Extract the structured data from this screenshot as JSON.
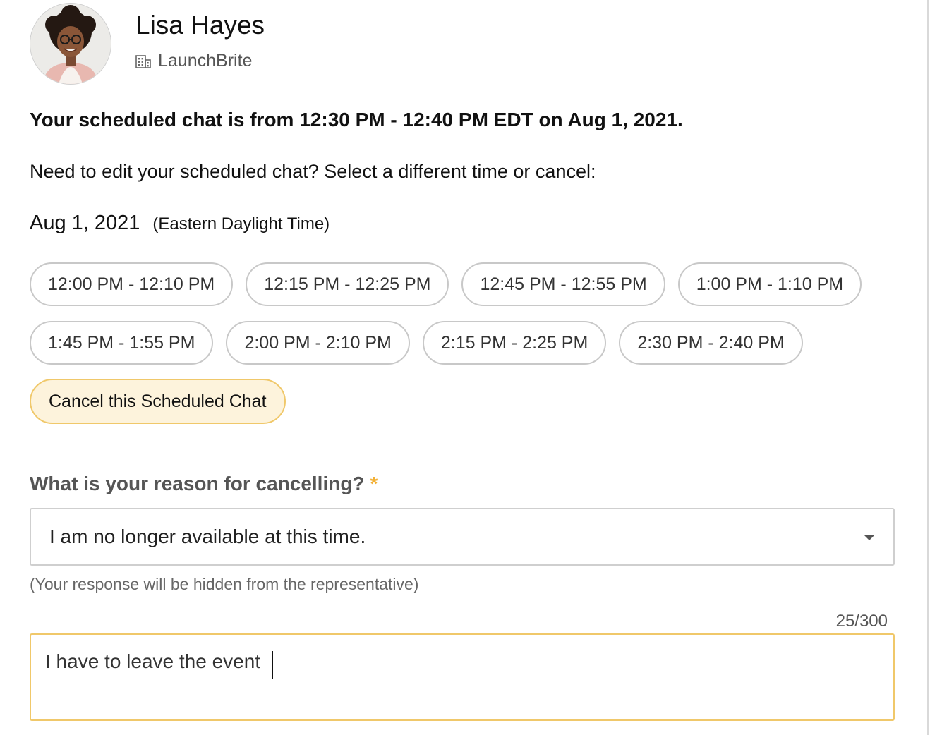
{
  "profile": {
    "name": "Lisa Hayes",
    "company": "LaunchBrite"
  },
  "schedule": {
    "confirmation": "Your scheduled chat is from 12:30 PM - 12:40 PM EDT on Aug 1, 2021.",
    "edit_prompt": "Need to edit your scheduled chat? Select a different time or cancel:",
    "date": "Aug 1, 2021",
    "timezone": "(Eastern Daylight Time)",
    "slots_row1": [
      "12:00 PM - 12:10 PM",
      "12:15 PM - 12:25 PM",
      "12:45 PM - 12:55 PM",
      "1:00 PM - 1:10 PM"
    ],
    "slots_row2": [
      "1:45 PM - 1:55 PM",
      "2:00 PM - 2:10 PM",
      "2:15 PM - 2:25 PM",
      "2:30 PM - 2:40 PM"
    ],
    "cancel_label": "Cancel this Scheduled Chat"
  },
  "cancel_form": {
    "reason_label": "What is your reason for cancelling?",
    "required_mark": "*",
    "selected_reason": "I am no longer available at this time.",
    "hint": "(Your response will be hidden from the representative)",
    "counter": "25/300",
    "comment_value": "I have to leave the event "
  },
  "colors": {
    "accent": "#f0c86a",
    "accent_bg": "#fdf3dc",
    "required": "#f2b035",
    "pill_border": "#c8c8c8"
  },
  "icons": {
    "avatar": "profile-photo",
    "company": "building-icon",
    "dropdown": "chevron-down-icon"
  }
}
